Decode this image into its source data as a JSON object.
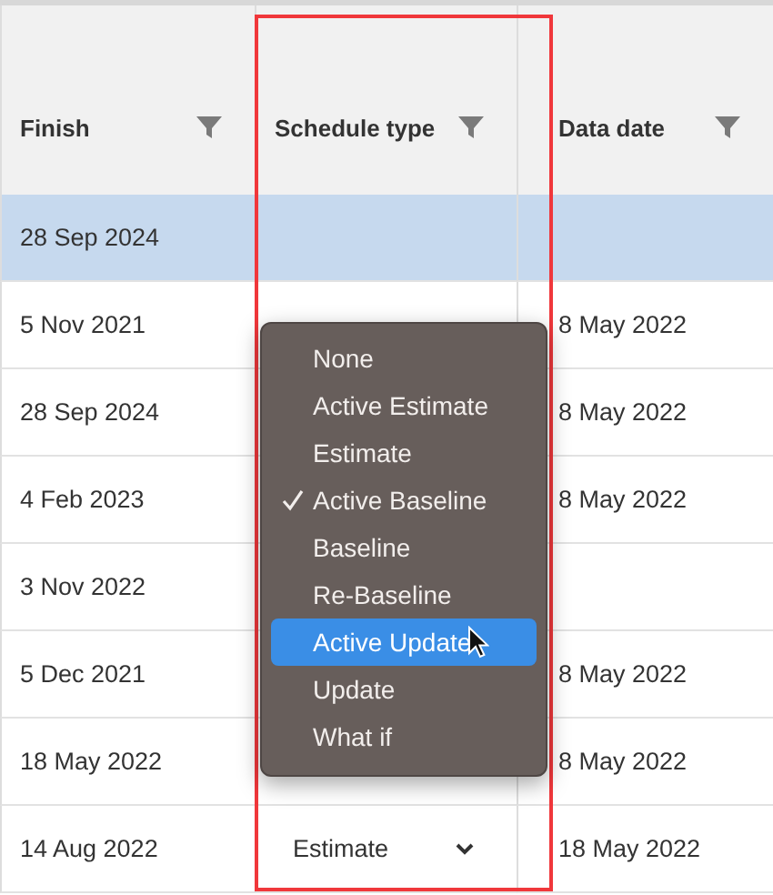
{
  "table": {
    "columns": [
      {
        "label": "Finish",
        "filter": true
      },
      {
        "label": "Schedule type",
        "filter": true
      },
      {
        "label": "Data date",
        "filter": true
      }
    ],
    "rows": [
      {
        "selected": true,
        "finish": "28 Sep 2024"
      },
      {
        "selected": false,
        "finish": "5 Nov 2021",
        "data_date": "8 May 2022"
      },
      {
        "selected": false,
        "finish": "28 Sep 2024",
        "data_date": "8 May 2022"
      },
      {
        "selected": false,
        "finish": "4 Feb 2023",
        "data_date": "8 May 2022"
      },
      {
        "selected": false,
        "finish": "3 Nov 2022"
      },
      {
        "selected": false,
        "finish": "5 Dec 2021",
        "data_date": "8 May 2022"
      },
      {
        "selected": false,
        "finish": "18 May 2022",
        "data_date": "8 May 2022"
      },
      {
        "selected": false,
        "finish": "14 Aug 2022",
        "schedule_type": "Estimate",
        "data_date": "18 May 2022"
      }
    ]
  },
  "schedule_menu": {
    "items": [
      {
        "label": "None",
        "checked": false,
        "highlighted": false
      },
      {
        "label": "Active Estimate",
        "checked": false,
        "highlighted": false
      },
      {
        "label": "Estimate",
        "checked": false,
        "highlighted": false
      },
      {
        "label": "Active Baseline",
        "checked": true,
        "highlighted": false
      },
      {
        "label": "Baseline",
        "checked": false,
        "highlighted": false
      },
      {
        "label": "Re-Baseline",
        "checked": false,
        "highlighted": false
      },
      {
        "label": "Active Update",
        "checked": false,
        "highlighted": true
      },
      {
        "label": "Update",
        "checked": false,
        "highlighted": false
      },
      {
        "label": "What if",
        "checked": false,
        "highlighted": false
      }
    ]
  }
}
